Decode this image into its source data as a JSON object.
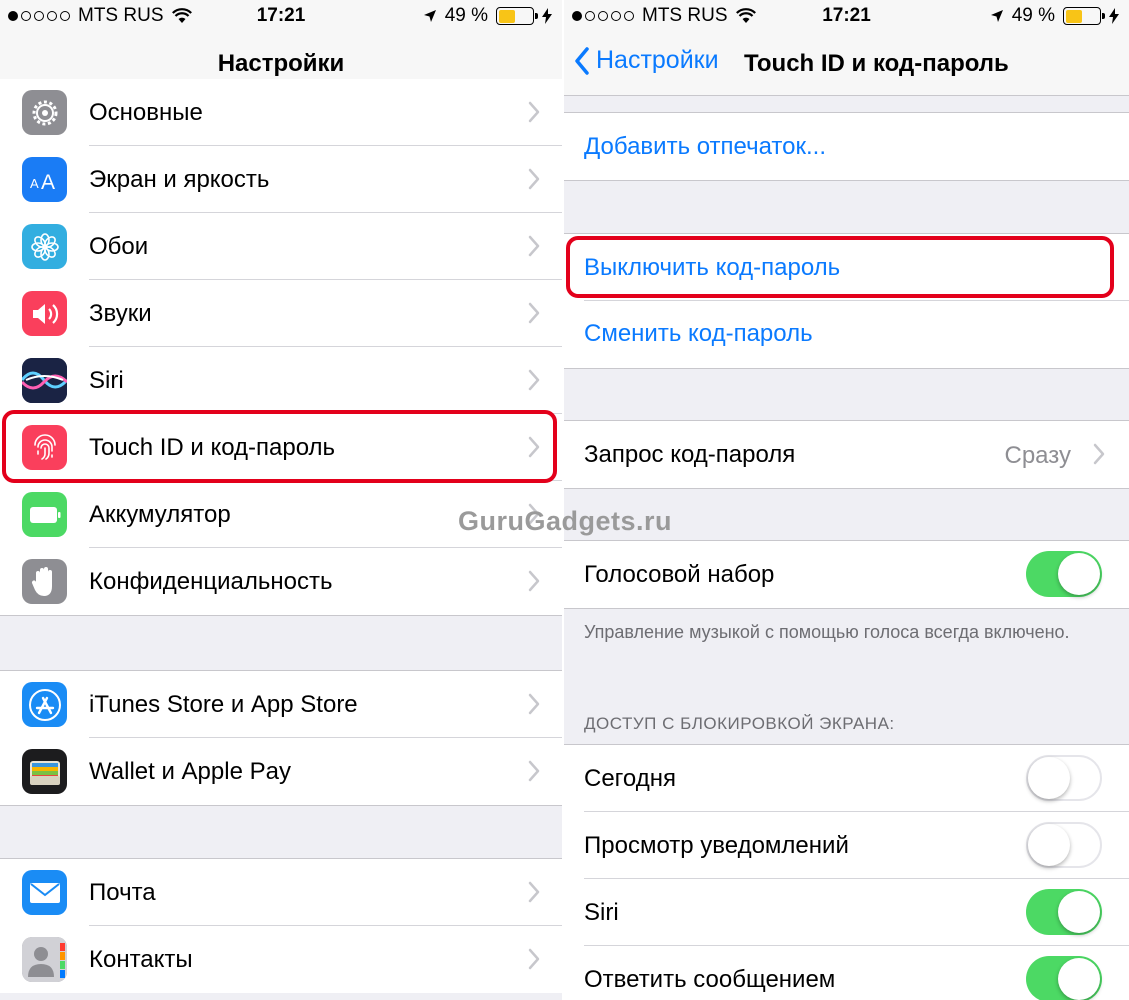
{
  "status_bar": {
    "carrier": "MTS RUS",
    "time": "17:21",
    "battery": "49 %",
    "battery_level": 0.49,
    "battery_color": "#f8c417"
  },
  "left": {
    "title": "Настройки",
    "items": [
      {
        "label": "Основные",
        "icon": "gear-icon",
        "color": "#8e8e93"
      },
      {
        "label": "Экран и яркость",
        "icon": "text-size-icon",
        "color": "#1a7cf5"
      },
      {
        "label": "Обои",
        "icon": "flower-icon",
        "color": "#32aee0"
      },
      {
        "label": "Звуки",
        "icon": "speaker-icon",
        "color": "#fa3f5c"
      },
      {
        "label": "Siri",
        "icon": "siri-icon",
        "color": "#1a2344"
      },
      {
        "label": "Touch ID и код-пароль",
        "icon": "fingerprint-icon",
        "color": "#fa3f5c"
      },
      {
        "label": "Аккумулятор",
        "icon": "battery-icon",
        "color": "#4cd964"
      },
      {
        "label": "Конфиденциальность",
        "icon": "hand-icon",
        "color": "#8e8e93"
      },
      {
        "label": "iTunes Store и App Store",
        "icon": "app-store-icon",
        "color": "#1a8cf5"
      },
      {
        "label": "Wallet и Apple Pay",
        "icon": "wallet-icon",
        "color": "#1c1c1e"
      },
      {
        "label": "Почта",
        "icon": "mail-icon",
        "color": "#1a8cf5"
      },
      {
        "label": "Контакты",
        "icon": "contacts-icon",
        "color": "#a0a0a5"
      }
    ]
  },
  "right": {
    "back_label": "Настройки",
    "title": "Touch ID и код-пароль",
    "add_fingerprint": "Добавить отпечаток...",
    "turn_off_passcode": "Выключить код-пароль",
    "change_passcode": "Сменить код-пароль",
    "require_passcode": {
      "label": "Запрос код-пароля",
      "value": "Сразу"
    },
    "voice_dial": {
      "label": "Голосовой набор",
      "on": true
    },
    "voice_dial_footer": "Управление музыкой с помощью голоса всегда включено.",
    "lock_section_header": "ДОСТУП С БЛОКИРОВКОЙ ЭКРАНА:",
    "lock_items": [
      {
        "label": "Сегодня",
        "on": false
      },
      {
        "label": "Просмотр уведомлений",
        "on": false
      },
      {
        "label": "Siri",
        "on": true
      },
      {
        "label": "Ответить сообщением",
        "on": true
      }
    ]
  },
  "watermark": "GuruGadgets.ru",
  "colors": {
    "accent": "#0a7aff",
    "highlight": "#e3001b",
    "toggle_on": "#4cd964"
  }
}
